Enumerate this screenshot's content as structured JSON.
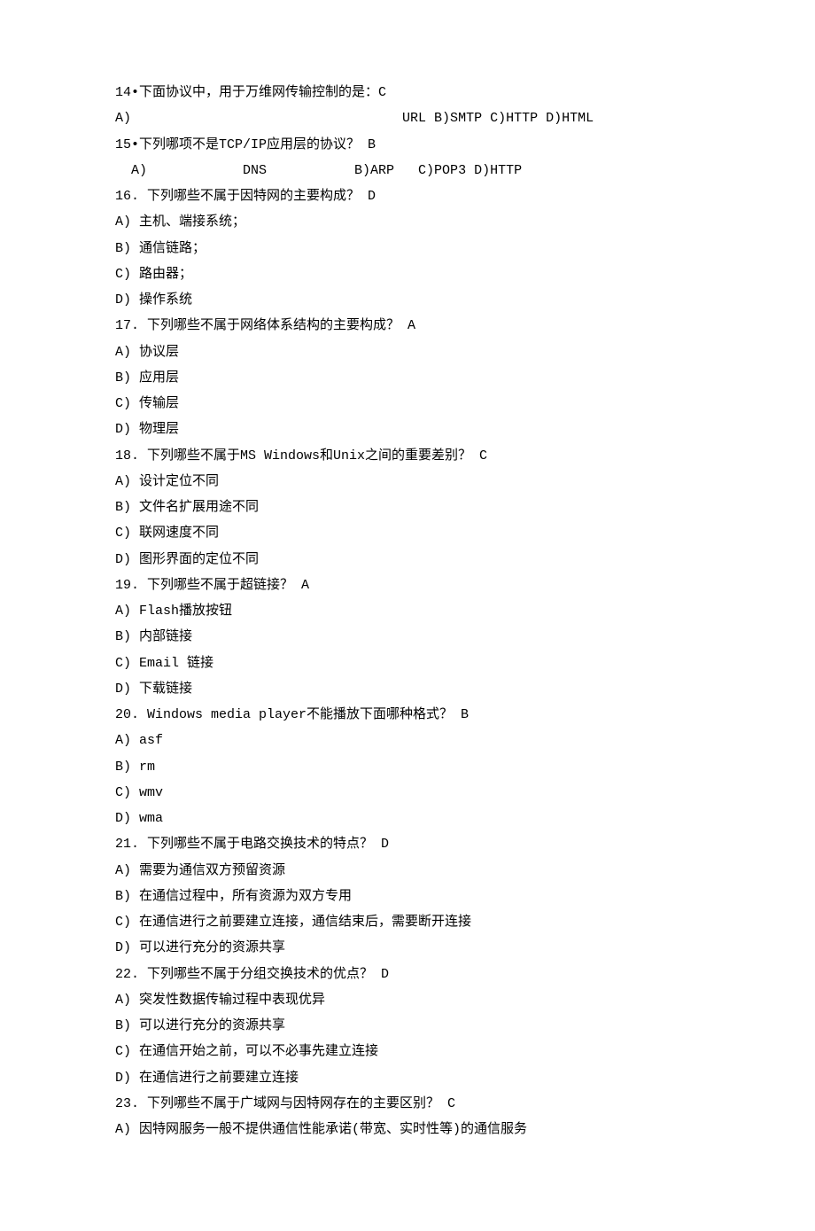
{
  "lines": [
    "14•下面协议中，用于万维网传输控制的是：C",
    "A)                                  URL B)SMTP C)HTTP D)HTML",
    "15•下列哪项不是TCP/IP应用层的协议？ B",
    "  A)            DNS           B)ARP   C)POP3 D)HTTP",
    "16. 下列哪些不属于因特网的主要构成？ D",
    "A) 主机、端接系统；",
    "B) 通信链路；",
    "C) 路由器；",
    "D) 操作系统",
    "17. 下列哪些不属于网络体系结构的主要构成？ A",
    "A) 协议层",
    "B) 应用层",
    "C) 传输层",
    "D) 物理层",
    "18. 下列哪些不属于MS Windows和Unix之间的重要差别？ C",
    "A) 设计定位不同",
    "B) 文件名扩展用途不同",
    "C) 联网速度不同",
    "D) 图形界面的定位不同",
    "19. 下列哪些不属于超链接？ A",
    "A) Flash播放按钮",
    "B) 内部链接",
    "C) Email 链接",
    "D) 下载链接",
    "20. Windows media player不能播放下面哪种格式？ B",
    "A) asf",
    "B) rm",
    "C) wmv",
    "D) wma",
    "21. 下列哪些不属于电路交换技术的特点？ D",
    "A) 需要为通信双方预留资源",
    "B) 在通信过程中，所有资源为双方专用",
    "C) 在通信进行之前要建立连接，通信结束后，需要断开连接",
    "D) 可以进行充分的资源共享",
    "22. 下列哪些不属于分组交换技术的优点？ D",
    "A) 突发性数据传输过程中表现优异",
    "B) 可以进行充分的资源共享",
    "C) 在通信开始之前，可以不必事先建立连接",
    "D) 在通信进行之前要建立连接",
    "23. 下列哪些不属于广域网与因特网存在的主要区别？ C",
    "A) 因特网服务一般不提供通信性能承诺(带宽、实时性等)的通信服务"
  ]
}
